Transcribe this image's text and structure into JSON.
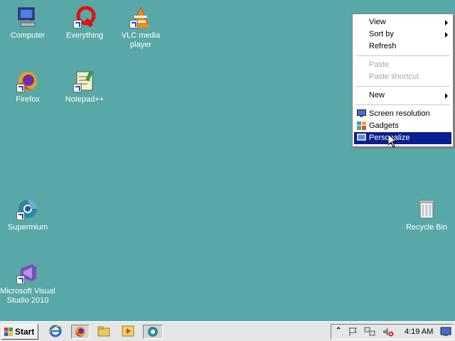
{
  "desktop": {
    "icons": [
      {
        "label": "Computer"
      },
      {
        "label": "Everything"
      },
      {
        "label": "VLC media player"
      },
      {
        "label": "Firefox"
      },
      {
        "label": "Notepad++"
      },
      {
        "label": "Supermium"
      },
      {
        "label": "Microsoft Visual Studio 2010"
      },
      {
        "label": "Recycle Bin"
      }
    ]
  },
  "context_menu": {
    "items": [
      {
        "label": "View",
        "submenu": true
      },
      {
        "label": "Sort by",
        "submenu": true
      },
      {
        "label": "Refresh"
      },
      {
        "label": "Paste",
        "disabled": true
      },
      {
        "label": "Paste shortcut",
        "disabled": true
      },
      {
        "label": "New",
        "submenu": true
      },
      {
        "label": "Screen resolution"
      },
      {
        "label": "Gadgets"
      },
      {
        "label": "Personalize",
        "highlighted": true
      }
    ]
  },
  "taskbar": {
    "start_label": "Start",
    "clock": "4:19 AM"
  },
  "colors": {
    "desktop": "#58a8a8",
    "menu_highlight": "#0a1f8f"
  }
}
